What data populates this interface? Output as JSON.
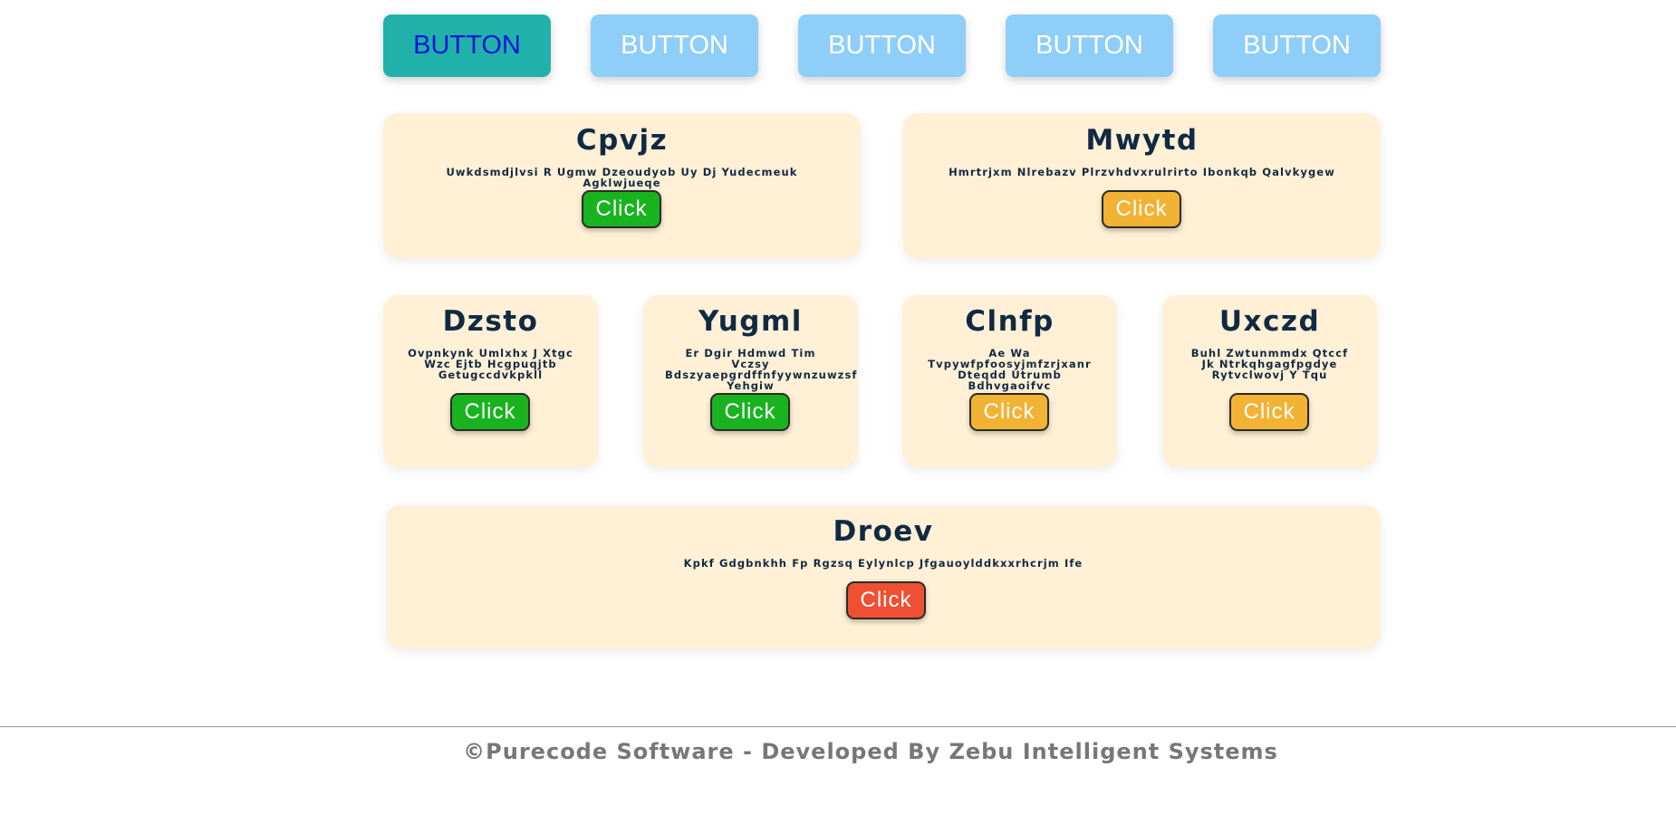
{
  "tabs": [
    "BUTTON",
    "BUTTON",
    "BUTTON",
    "BUTTON",
    "BUTTON"
  ],
  "cards": [
    {
      "title": "Cpvjz",
      "desc": "Uwkdsmdjlvsi R Ugmw Dzeoudyob Uy Dj Yudecmeuk Agklwjueqe",
      "button": "Click",
      "button_color": "#19b31f"
    },
    {
      "title": "Mwytd",
      "desc": "Hmrtrjxm Nlrebazv Plrzvhdvxrulrirto Ibonkqb Qalvkygew",
      "button": "Click",
      "button_color": "#f2b233"
    },
    {
      "title": "Dzsto",
      "desc": "Ovpnkynk Umlxhx J Xtgc Wzc Ejtb Hcgpuqjtb Getugccdvkpkll",
      "button": "Click",
      "button_color": "#19b31f"
    },
    {
      "title": "Yugml",
      "desc": "Er Dgir Hdmwd Tim Vczsy Bdszyaepgrdffnfyywnzuwzsf Yehgiw",
      "button": "Click",
      "button_color": "#19b31f"
    },
    {
      "title": "Clnfp",
      "desc": "Ae Wa Tvpywfpfoosyjmfzrjxanr Dteqdd Utrumb Bdhvgaoifvc",
      "button": "Click",
      "button_color": "#f2b233"
    },
    {
      "title": "Uxczd",
      "desc": "Buhl Zwtunmmdx Qtccf Jk Ntrkqhgagfpgdye Rytvclwovj Y Tqu",
      "button": "Click",
      "button_color": "#f2b233"
    },
    {
      "title": "Droev",
      "desc": "Kpkf Gdgbnkhh Fp Rgzsq Eylynlcp Jfgauoylddkxxrhcrjm Ife",
      "button": "Click",
      "button_color": "#ef4f32"
    }
  ],
  "footer": "©Purecode Software - Developed By Zebu Intelligent Systems",
  "colors": {
    "tab_active_bg": "#20b2aa",
    "tab_active_text": "#0a14d8",
    "tab_bg": "#8ecef8",
    "card_bg": "#fff0d6",
    "title_text": "#102a43"
  }
}
